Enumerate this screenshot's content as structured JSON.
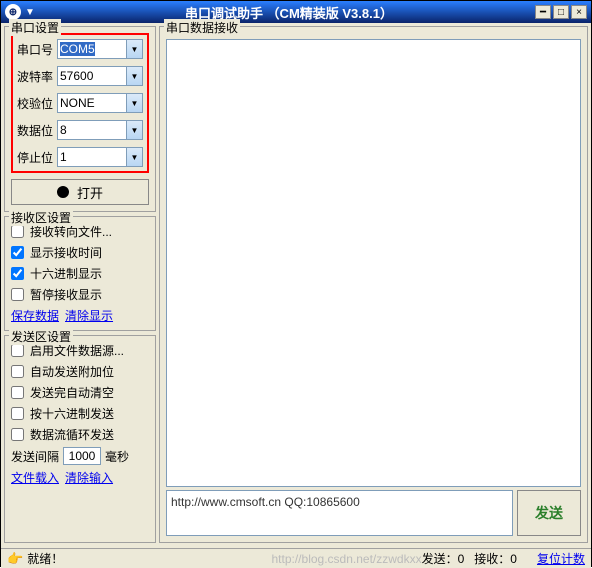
{
  "window": {
    "title": "串口调试助手 （CM精装版 V3.8.1）"
  },
  "serialSettings": {
    "title": "串口设置",
    "port": {
      "label": "串口号",
      "value": "COM5"
    },
    "baud": {
      "label": "波特率",
      "value": "57600"
    },
    "parity": {
      "label": "校验位",
      "value": "NONE"
    },
    "databits": {
      "label": "数据位",
      "value": "8"
    },
    "stopbits": {
      "label": "停止位",
      "value": "1"
    },
    "openBtn": "打开"
  },
  "recvSettings": {
    "title": "接收区设置",
    "toFile": "接收转向文件...",
    "showTime": "显示接收时间",
    "hexShow": "十六进制显示",
    "pause": "暂停接收显示",
    "saveLink": "保存数据",
    "clearLink": "清除显示"
  },
  "sendSettings": {
    "title": "发送区设置",
    "fileSource": "启用文件数据源...",
    "autoAppend": "自动发送附加位",
    "autoClear": "发送完自动清空",
    "hexSend": "按十六进制发送",
    "cycleSend": "数据流循环发送",
    "intervalLabel": "发送间隔",
    "intervalValue": "1000",
    "intervalUnit": "毫秒",
    "fileLoad": "文件载入",
    "clearInput": "清除输入"
  },
  "recvArea": {
    "title": "串口数据接收"
  },
  "sendArea": {
    "text": "http://www.cmsoft.cn QQ:10865600",
    "sendBtn": "发送"
  },
  "status": {
    "ready": "就绪！",
    "watermark": "http://blog.csdn.net/zzwdkxx",
    "sendLabel": "发送：",
    "sendCount": "0",
    "recvLabel": "接收：",
    "recvCount": "0",
    "reset": "复位计数"
  }
}
